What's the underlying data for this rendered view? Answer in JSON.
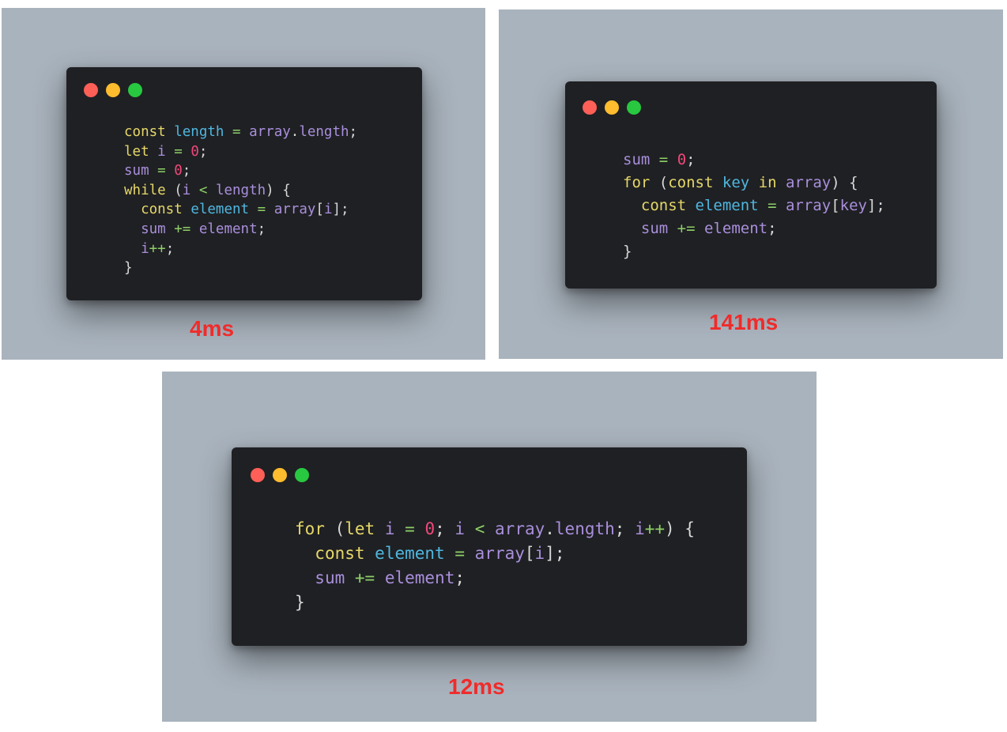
{
  "panels": [
    {
      "id": "a",
      "timing": "4ms",
      "window_dots": [
        "close",
        "minimize",
        "zoom"
      ],
      "code_lines": [
        [
          [
            "kw",
            "const"
          ],
          [
            "punct",
            " "
          ],
          [
            "ident",
            "length"
          ],
          [
            "punct",
            " "
          ],
          [
            "op",
            "="
          ],
          [
            "punct",
            " "
          ],
          [
            "var",
            "array"
          ],
          [
            "punct",
            "."
          ],
          [
            "var",
            "length"
          ],
          [
            "punct",
            ";"
          ]
        ],
        [
          [
            "kw",
            "let"
          ],
          [
            "punct",
            " "
          ],
          [
            "var",
            "i"
          ],
          [
            "punct",
            " "
          ],
          [
            "op",
            "="
          ],
          [
            "punct",
            " "
          ],
          [
            "num",
            "0"
          ],
          [
            "punct",
            ";"
          ]
        ],
        [
          [
            "var",
            "sum"
          ],
          [
            "punct",
            " "
          ],
          [
            "op",
            "="
          ],
          [
            "punct",
            " "
          ],
          [
            "num",
            "0"
          ],
          [
            "punct",
            ";"
          ]
        ],
        [
          [
            "kw",
            "while"
          ],
          [
            "punct",
            " ("
          ],
          [
            "var",
            "i"
          ],
          [
            "punct",
            " "
          ],
          [
            "op",
            "<"
          ],
          [
            "punct",
            " "
          ],
          [
            "var",
            "length"
          ],
          [
            "punct",
            ") {"
          ]
        ],
        [
          [
            "punct",
            "  "
          ],
          [
            "kw",
            "const"
          ],
          [
            "punct",
            " "
          ],
          [
            "ident",
            "element"
          ],
          [
            "punct",
            " "
          ],
          [
            "op",
            "="
          ],
          [
            "punct",
            " "
          ],
          [
            "var",
            "array"
          ],
          [
            "punct",
            "["
          ],
          [
            "var",
            "i"
          ],
          [
            "punct",
            "];"
          ]
        ],
        [
          [
            "punct",
            "  "
          ],
          [
            "var",
            "sum"
          ],
          [
            "punct",
            " "
          ],
          [
            "op",
            "+="
          ],
          [
            "punct",
            " "
          ],
          [
            "var",
            "element"
          ],
          [
            "punct",
            ";"
          ]
        ],
        [
          [
            "punct",
            "  "
          ],
          [
            "var",
            "i"
          ],
          [
            "op",
            "++"
          ],
          [
            "punct",
            ";"
          ]
        ],
        [
          [
            "punct",
            "}"
          ]
        ]
      ]
    },
    {
      "id": "b",
      "timing": "141ms",
      "window_dots": [
        "close",
        "minimize",
        "zoom"
      ],
      "code_lines": [
        [
          [
            "var",
            "sum"
          ],
          [
            "punct",
            " "
          ],
          [
            "op",
            "="
          ],
          [
            "punct",
            " "
          ],
          [
            "num",
            "0"
          ],
          [
            "punct",
            ";"
          ]
        ],
        [
          [
            "kw",
            "for"
          ],
          [
            "punct",
            " ("
          ],
          [
            "kw",
            "const"
          ],
          [
            "punct",
            " "
          ],
          [
            "ident",
            "key"
          ],
          [
            "punct",
            " "
          ],
          [
            "kw",
            "in"
          ],
          [
            "punct",
            " "
          ],
          [
            "var",
            "array"
          ],
          [
            "punct",
            ") {"
          ]
        ],
        [
          [
            "punct",
            "  "
          ],
          [
            "kw",
            "const"
          ],
          [
            "punct",
            " "
          ],
          [
            "ident",
            "element"
          ],
          [
            "punct",
            " "
          ],
          [
            "op",
            "="
          ],
          [
            "punct",
            " "
          ],
          [
            "var",
            "array"
          ],
          [
            "punct",
            "["
          ],
          [
            "var",
            "key"
          ],
          [
            "punct",
            "];"
          ]
        ],
        [
          [
            "punct",
            "  "
          ],
          [
            "var",
            "sum"
          ],
          [
            "punct",
            " "
          ],
          [
            "op",
            "+="
          ],
          [
            "punct",
            " "
          ],
          [
            "var",
            "element"
          ],
          [
            "punct",
            ";"
          ]
        ],
        [
          [
            "punct",
            "}"
          ]
        ]
      ]
    },
    {
      "id": "c",
      "timing": "12ms",
      "window_dots": [
        "close",
        "minimize",
        "zoom"
      ],
      "code_lines": [
        [
          [
            "kw",
            "for"
          ],
          [
            "punct",
            " ("
          ],
          [
            "kw",
            "let"
          ],
          [
            "punct",
            " "
          ],
          [
            "var",
            "i"
          ],
          [
            "punct",
            " "
          ],
          [
            "op",
            "="
          ],
          [
            "punct",
            " "
          ],
          [
            "num",
            "0"
          ],
          [
            "punct",
            "; "
          ],
          [
            "var",
            "i"
          ],
          [
            "punct",
            " "
          ],
          [
            "op",
            "<"
          ],
          [
            "punct",
            " "
          ],
          [
            "var",
            "array"
          ],
          [
            "punct",
            "."
          ],
          [
            "var",
            "length"
          ],
          [
            "punct",
            "; "
          ],
          [
            "var",
            "i"
          ],
          [
            "op",
            "++"
          ],
          [
            "punct",
            ") {"
          ]
        ],
        [
          [
            "punct",
            "  "
          ],
          [
            "kw",
            "const"
          ],
          [
            "punct",
            " "
          ],
          [
            "ident",
            "element"
          ],
          [
            "punct",
            " "
          ],
          [
            "op",
            "="
          ],
          [
            "punct",
            " "
          ],
          [
            "var",
            "array"
          ],
          [
            "punct",
            "["
          ],
          [
            "var",
            "i"
          ],
          [
            "punct",
            "];"
          ]
        ],
        [
          [
            "punct",
            "  "
          ],
          [
            "var",
            "sum"
          ],
          [
            "punct",
            " "
          ],
          [
            "op",
            "+="
          ],
          [
            "punct",
            " "
          ],
          [
            "var",
            "element"
          ],
          [
            "punct",
            ";"
          ]
        ],
        [
          [
            "punct",
            "}"
          ]
        ]
      ]
    }
  ],
  "colors": {
    "keyword": "#e6d86a",
    "variable": "#a98fdc",
    "identifier": "#4fb7e0",
    "operator": "#8ed068",
    "number": "#f0487a",
    "timing": "#f02b2b",
    "window_bg": "#1f2023",
    "panel_bg": "#a9b3bd",
    "dot_close": "#fe5f57",
    "dot_minimize": "#febc2e",
    "dot_zoom": "#28c840"
  }
}
